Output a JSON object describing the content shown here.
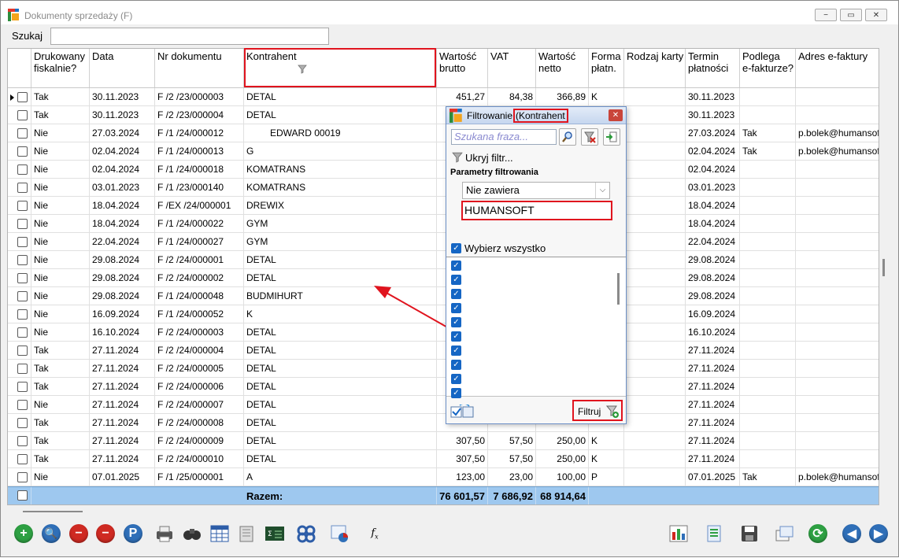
{
  "window": {
    "title": "Dokumenty sprzedaży (F)",
    "buttons": [
      "−",
      "▭",
      "✕"
    ]
  },
  "search": {
    "label": "Szukaj",
    "value": ""
  },
  "columns": [
    "",
    "Drukowany\nfiskalnie?",
    "Data",
    "Nr dokumentu",
    "Kontrahent",
    "Wartość\nbrutto",
    "VAT",
    "Wartość\nnetto",
    "Forma\npłatn.",
    "Rodzaj karty",
    "Termin\npłatności",
    "Podlega\ne-fakturze?",
    "Adres e-faktury"
  ],
  "rows": [
    [
      "Tak",
      "30.11.2023",
      "F /2  /23/000003",
      "DETAL",
      "451,27",
      "84,38",
      "366,89",
      "K",
      "",
      "30.11.2023",
      "",
      ""
    ],
    [
      "Tak",
      "30.11.2023",
      "F /2  /23/000004",
      "DETAL",
      "",
      "",
      "",
      "",
      "",
      "30.11.2023",
      "",
      ""
    ],
    [
      "Nie",
      "27.03.2024",
      "F /1  /24/000012",
      "EDWARD 00019",
      "",
      "",
      "",
      "",
      "",
      "27.03.2024",
      "Tak",
      "p.bolek@humansoft"
    ],
    [
      "Nie",
      "02.04.2024",
      "F /1  /24/000013",
      "G",
      "",
      "",
      "",
      "",
      "",
      "02.04.2024",
      "Tak",
      "p.bolek@humansoft"
    ],
    [
      "Nie",
      "02.04.2024",
      "F /1  /24/000018",
      "KOMATRANS",
      "",
      "",
      "",
      "",
      "",
      "02.04.2024",
      "",
      ""
    ],
    [
      "Nie",
      "03.01.2023",
      "F /1  /23/000140",
      "KOMATRANS",
      "",
      "",
      "",
      "",
      "",
      "03.01.2023",
      "",
      ""
    ],
    [
      "Nie",
      "18.04.2024",
      "F /EX /24/000001",
      "DREWIX",
      "",
      "",
      "",
      "",
      "",
      "18.04.2024",
      "",
      ""
    ],
    [
      "Nie",
      "18.04.2024",
      "F /1  /24/000022",
      "GYM",
      "",
      "",
      "",
      "",
      "",
      "18.04.2024",
      "",
      ""
    ],
    [
      "Nie",
      "22.04.2024",
      "F /1  /24/000027",
      "GYM",
      "",
      "",
      "",
      "",
      "",
      "22.04.2024",
      "",
      ""
    ],
    [
      "Nie",
      "29.08.2024",
      "F /2  /24/000001",
      "DETAL",
      "",
      "",
      "",
      "",
      "",
      "29.08.2024",
      "",
      ""
    ],
    [
      "Nie",
      "29.08.2024",
      "F /2  /24/000002",
      "DETAL",
      "",
      "",
      "",
      "",
      "",
      "29.08.2024",
      "",
      ""
    ],
    [
      "Nie",
      "29.08.2024",
      "F /1  /24/000048",
      "BUDMIHURT",
      "",
      "",
      "",
      "",
      "",
      "29.08.2024",
      "",
      ""
    ],
    [
      "Nie",
      "16.09.2024",
      "F /1  /24/000052",
      "K",
      "",
      "",
      "",
      "",
      "",
      "16.09.2024",
      "",
      ""
    ],
    [
      "Nie",
      "16.10.2024",
      "F /2  /24/000003",
      "DETAL",
      "",
      "",
      "",
      "",
      "",
      "16.10.2024",
      "",
      ""
    ],
    [
      "Tak",
      "27.11.2024",
      "F /2  /24/000004",
      "DETAL",
      "",
      "",
      "",
      "",
      "",
      "27.11.2024",
      "",
      ""
    ],
    [
      "Tak",
      "27.11.2024",
      "F /2  /24/000005",
      "DETAL",
      "",
      "",
      "",
      "",
      "",
      "27.11.2024",
      "",
      ""
    ],
    [
      "Tak",
      "27.11.2024",
      "F /2  /24/000006",
      "DETAL",
      "",
      "",
      "",
      "",
      "",
      "27.11.2024",
      "",
      ""
    ],
    [
      "Nie",
      "27.11.2024",
      "F /2  /24/000007",
      "DETAL",
      "",
      "",
      "",
      "",
      "",
      "27.11.2024",
      "",
      ""
    ],
    [
      "Tak",
      "27.11.2024",
      "F /2  /24/000008",
      "DETAL",
      "",
      "",
      "",
      "",
      "",
      "27.11.2024",
      "",
      ""
    ],
    [
      "Tak",
      "27.11.2024",
      "F /2  /24/000009",
      "DETAL",
      "307,50",
      "57,50",
      "250,00",
      "K",
      "",
      "27.11.2024",
      "",
      ""
    ],
    [
      "Tak",
      "27.11.2024",
      "F /2  /24/000010",
      "DETAL",
      "307,50",
      "57,50",
      "250,00",
      "K",
      "",
      "27.11.2024",
      "",
      ""
    ],
    [
      "Nie",
      "07.01.2025",
      "F /1  /25/000001",
      "A",
      "123,00",
      "23,00",
      "100,00",
      "P",
      "",
      "07.01.2025",
      "Tak",
      "p.bolek@humansoft"
    ]
  ],
  "totals": {
    "label": "Razem:",
    "brutto": "76 601,57",
    "vat": "7 686,92",
    "netto": "68 914,64"
  },
  "filter_dialog": {
    "title": "Filtrowanie",
    "column_name": "(Kontrahent",
    "search_placeholder": "Szukana fraza...",
    "hide_filter": "Ukryj filtr...",
    "params_label": "Parametry filtrowania",
    "condition": "Nie zawiera",
    "value": "HUMANSOFT",
    "select_all": "Wybierz wszystko",
    "filter_button": "Filtruj",
    "list_count": 10
  },
  "toolbar_left": [
    "add",
    "preview",
    "delete",
    "cancel",
    "post",
    "print",
    "find",
    "table",
    "export",
    "calc",
    "settings",
    "chart",
    "formula"
  ],
  "toolbar_right": [
    "report",
    "document",
    "save",
    "windows",
    "refresh",
    "prev",
    "next"
  ],
  "colors": {
    "accent": "#1566c4",
    "highlight": "#e0141e",
    "total_row": "#9ec8ef"
  }
}
